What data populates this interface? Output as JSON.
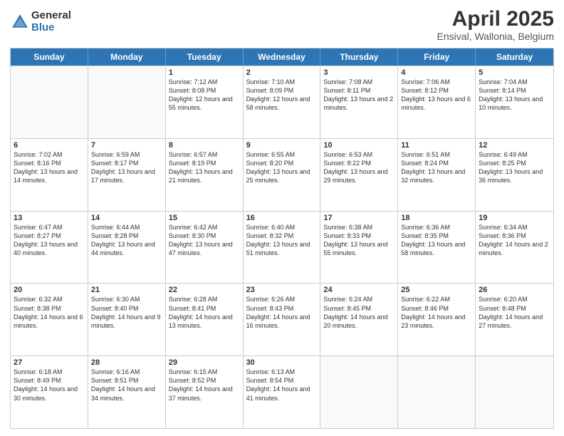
{
  "logo": {
    "general": "General",
    "blue": "Blue"
  },
  "title": "April 2025",
  "subtitle": "Ensival, Wallonia, Belgium",
  "header_days": [
    "Sunday",
    "Monday",
    "Tuesday",
    "Wednesday",
    "Thursday",
    "Friday",
    "Saturday"
  ],
  "weeks": [
    [
      {
        "day": "",
        "info": ""
      },
      {
        "day": "",
        "info": ""
      },
      {
        "day": "1",
        "info": "Sunrise: 7:12 AM\nSunset: 8:08 PM\nDaylight: 12 hours and 55 minutes."
      },
      {
        "day": "2",
        "info": "Sunrise: 7:10 AM\nSunset: 8:09 PM\nDaylight: 12 hours and 58 minutes."
      },
      {
        "day": "3",
        "info": "Sunrise: 7:08 AM\nSunset: 8:11 PM\nDaylight: 13 hours and 2 minutes."
      },
      {
        "day": "4",
        "info": "Sunrise: 7:06 AM\nSunset: 8:12 PM\nDaylight: 13 hours and 6 minutes."
      },
      {
        "day": "5",
        "info": "Sunrise: 7:04 AM\nSunset: 8:14 PM\nDaylight: 13 hours and 10 minutes."
      }
    ],
    [
      {
        "day": "6",
        "info": "Sunrise: 7:02 AM\nSunset: 8:16 PM\nDaylight: 13 hours and 14 minutes."
      },
      {
        "day": "7",
        "info": "Sunrise: 6:59 AM\nSunset: 8:17 PM\nDaylight: 13 hours and 17 minutes."
      },
      {
        "day": "8",
        "info": "Sunrise: 6:57 AM\nSunset: 8:19 PM\nDaylight: 13 hours and 21 minutes."
      },
      {
        "day": "9",
        "info": "Sunrise: 6:55 AM\nSunset: 8:20 PM\nDaylight: 13 hours and 25 minutes."
      },
      {
        "day": "10",
        "info": "Sunrise: 6:53 AM\nSunset: 8:22 PM\nDaylight: 13 hours and 29 minutes."
      },
      {
        "day": "11",
        "info": "Sunrise: 6:51 AM\nSunset: 8:24 PM\nDaylight: 13 hours and 32 minutes."
      },
      {
        "day": "12",
        "info": "Sunrise: 6:49 AM\nSunset: 8:25 PM\nDaylight: 13 hours and 36 minutes."
      }
    ],
    [
      {
        "day": "13",
        "info": "Sunrise: 6:47 AM\nSunset: 8:27 PM\nDaylight: 13 hours and 40 minutes."
      },
      {
        "day": "14",
        "info": "Sunrise: 6:44 AM\nSunset: 8:28 PM\nDaylight: 13 hours and 44 minutes."
      },
      {
        "day": "15",
        "info": "Sunrise: 6:42 AM\nSunset: 8:30 PM\nDaylight: 13 hours and 47 minutes."
      },
      {
        "day": "16",
        "info": "Sunrise: 6:40 AM\nSunset: 8:32 PM\nDaylight: 13 hours and 51 minutes."
      },
      {
        "day": "17",
        "info": "Sunrise: 6:38 AM\nSunset: 8:33 PM\nDaylight: 13 hours and 55 minutes."
      },
      {
        "day": "18",
        "info": "Sunrise: 6:36 AM\nSunset: 8:35 PM\nDaylight: 13 hours and 58 minutes."
      },
      {
        "day": "19",
        "info": "Sunrise: 6:34 AM\nSunset: 8:36 PM\nDaylight: 14 hours and 2 minutes."
      }
    ],
    [
      {
        "day": "20",
        "info": "Sunrise: 6:32 AM\nSunset: 8:38 PM\nDaylight: 14 hours and 6 minutes."
      },
      {
        "day": "21",
        "info": "Sunrise: 6:30 AM\nSunset: 8:40 PM\nDaylight: 14 hours and 9 minutes."
      },
      {
        "day": "22",
        "info": "Sunrise: 6:28 AM\nSunset: 8:41 PM\nDaylight: 14 hours and 13 minutes."
      },
      {
        "day": "23",
        "info": "Sunrise: 6:26 AM\nSunset: 8:43 PM\nDaylight: 14 hours and 16 minutes."
      },
      {
        "day": "24",
        "info": "Sunrise: 6:24 AM\nSunset: 8:45 PM\nDaylight: 14 hours and 20 minutes."
      },
      {
        "day": "25",
        "info": "Sunrise: 6:22 AM\nSunset: 8:46 PM\nDaylight: 14 hours and 23 minutes."
      },
      {
        "day": "26",
        "info": "Sunrise: 6:20 AM\nSunset: 8:48 PM\nDaylight: 14 hours and 27 minutes."
      }
    ],
    [
      {
        "day": "27",
        "info": "Sunrise: 6:18 AM\nSunset: 8:49 PM\nDaylight: 14 hours and 30 minutes."
      },
      {
        "day": "28",
        "info": "Sunrise: 6:16 AM\nSunset: 8:51 PM\nDaylight: 14 hours and 34 minutes."
      },
      {
        "day": "29",
        "info": "Sunrise: 6:15 AM\nSunset: 8:52 PM\nDaylight: 14 hours and 37 minutes."
      },
      {
        "day": "30",
        "info": "Sunrise: 6:13 AM\nSunset: 8:54 PM\nDaylight: 14 hours and 41 minutes."
      },
      {
        "day": "",
        "info": ""
      },
      {
        "day": "",
        "info": ""
      },
      {
        "day": "",
        "info": ""
      }
    ]
  ]
}
